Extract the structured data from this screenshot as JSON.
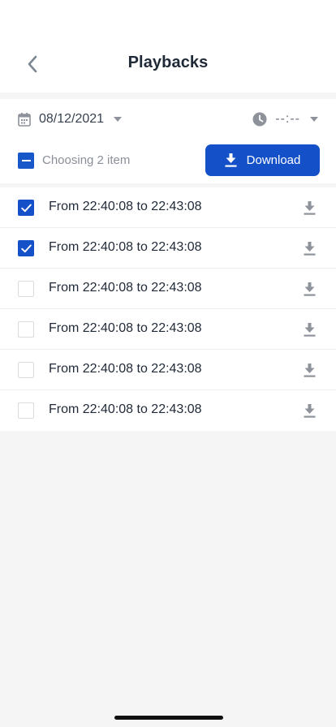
{
  "header": {
    "title": "Playbacks",
    "back_icon": "chevron-left-icon"
  },
  "filters": {
    "date": "08/12/2021",
    "time": "--:--"
  },
  "selection": {
    "summary": "Choosing 2 item",
    "download_label": "Download"
  },
  "rows": [
    {
      "label": "From 22:40:08 to 22:43:08",
      "checked": true
    },
    {
      "label": "From 22:40:08 to 22:43:08",
      "checked": true
    },
    {
      "label": "From 22:40:08 to 22:43:08",
      "checked": false
    },
    {
      "label": "From 22:40:08 to 22:43:08",
      "checked": false
    },
    {
      "label": "From 22:40:08 to 22:43:08",
      "checked": false
    },
    {
      "label": "From 22:40:08 to 22:43:08",
      "checked": false
    }
  ],
  "colors": {
    "accent": "#1451c9",
    "icon_gray": "#8e939b",
    "background": "#f5f5f5"
  }
}
